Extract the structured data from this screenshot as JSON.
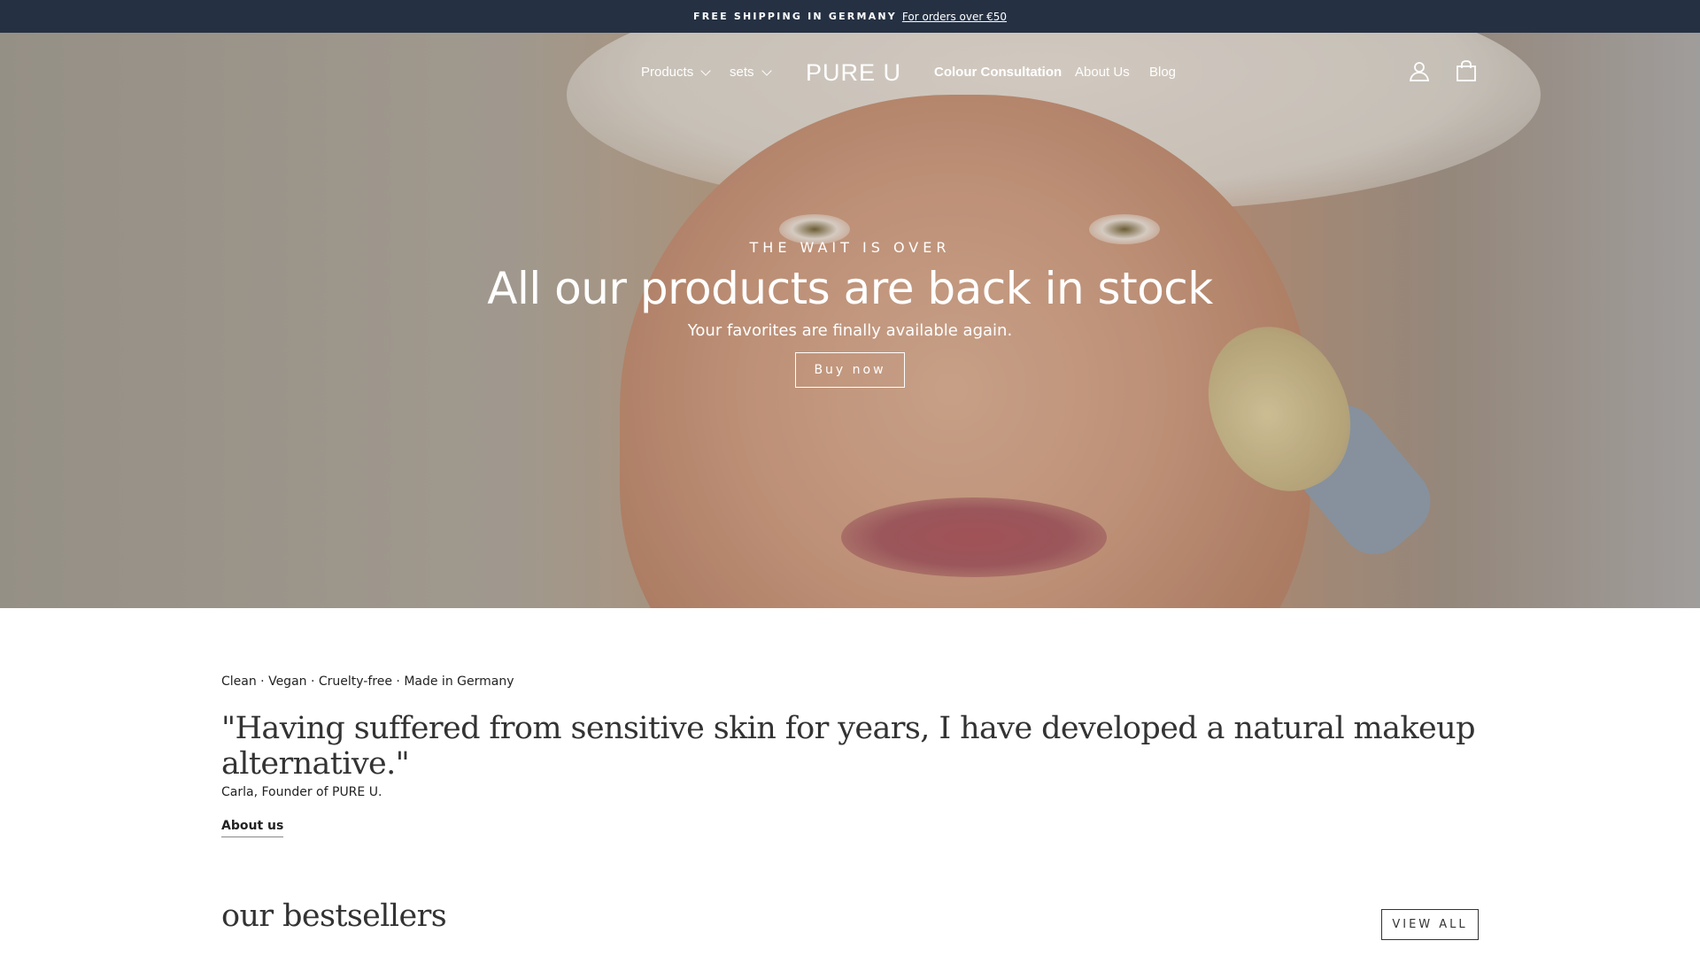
{
  "announcement": {
    "strong_text": "FREE SHIPPING IN GERMANY",
    "link_text": "For orders over €50"
  },
  "nav": {
    "products": "Products",
    "sets": "sets",
    "logo": "PURE U",
    "colour_consultation": "Colour Consultation",
    "about_us": "About Us",
    "blog": "Blog",
    "account_icon": "user-icon",
    "cart_icon": "shopping-bag-icon"
  },
  "hero": {
    "eyebrow": "THE WAIT IS OVER",
    "title": "All our products are back in stock",
    "subtitle": "Your favorites are finally available again.",
    "button": "Buy now"
  },
  "intro": {
    "tags": "Clean · Vegan · Cruelty-free · Made in Germany",
    "quote": "\"Having suffered from sensitive skin for years, I have developed a natural makeup alternative.\"",
    "author": "Carla, Founder of PURE U.",
    "about_link": "About us"
  },
  "bestsellers": {
    "title": "our bestsellers",
    "view_all": "VIEW ALL"
  },
  "colors": {
    "announcement_bg": "#253143",
    "text": "#333333"
  }
}
